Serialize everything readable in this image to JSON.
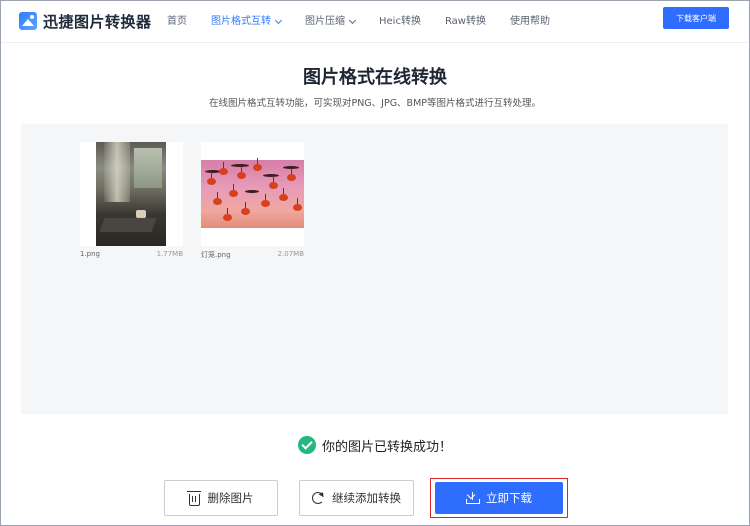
{
  "header": {
    "logo_text": "迅捷图片转换器",
    "nav": [
      {
        "label": "首页",
        "active": false,
        "dropdown": false
      },
      {
        "label": "图片格式互转",
        "active": true,
        "dropdown": true
      },
      {
        "label": "图片压缩",
        "active": false,
        "dropdown": true
      },
      {
        "label": "Heic转换",
        "active": false,
        "dropdown": false
      },
      {
        "label": "Raw转换",
        "active": false,
        "dropdown": false
      },
      {
        "label": "使用帮助",
        "active": false,
        "dropdown": false
      }
    ],
    "download_client_label": "下载客户端"
  },
  "main": {
    "title": "图片格式在线转换",
    "subtitle": "在线图片格式互转功能，可实现对PNG、JPG、BMP等图片格式进行互转处理。"
  },
  "files": [
    {
      "name": "1.png",
      "size": "1.77MB"
    },
    {
      "name": "灯笼.png",
      "size": "2.07MB"
    }
  ],
  "status": {
    "success_text": "你的图片已转换成功！"
  },
  "actions": {
    "delete_label": "删除图片",
    "continue_label": "继续添加转换",
    "download_label": "立即下载"
  },
  "colors": {
    "accent": "#2f6dff",
    "success": "#21b97e",
    "highlight_border": "#e0222b"
  }
}
